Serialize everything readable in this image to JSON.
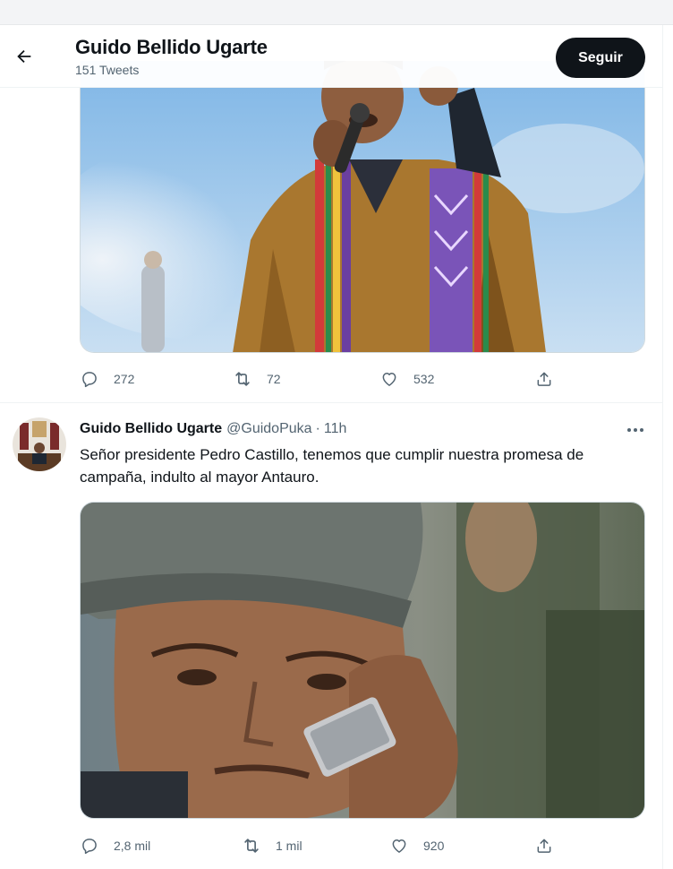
{
  "header": {
    "title": "Guido Bellido Ugarte",
    "tweet_count": "151 Tweets",
    "follow_label": "Seguir"
  },
  "tweet1": {
    "replies": "272",
    "retweets": "72",
    "likes": "532"
  },
  "tweet2": {
    "author_name": "Guido Bellido Ugarte",
    "handle": "@GuidoPuka",
    "separator": "·",
    "time": "11h",
    "text": "Señor presidente Pedro Castillo, tenemos que cumplir nuestra promesa de campaña, indulto al mayor Antauro.",
    "replies": "2,8 mil",
    "retweets": "1 mil",
    "likes": "920"
  },
  "icons": {
    "back": "arrow-left-icon",
    "reply": "reply-icon",
    "retweet": "retweet-icon",
    "like": "heart-icon",
    "share": "share-icon",
    "more": "more-icon"
  },
  "colors": {
    "text": "#0f1419",
    "muted": "#536471",
    "border": "#eff3f4",
    "follow_bg": "#0f1419"
  }
}
